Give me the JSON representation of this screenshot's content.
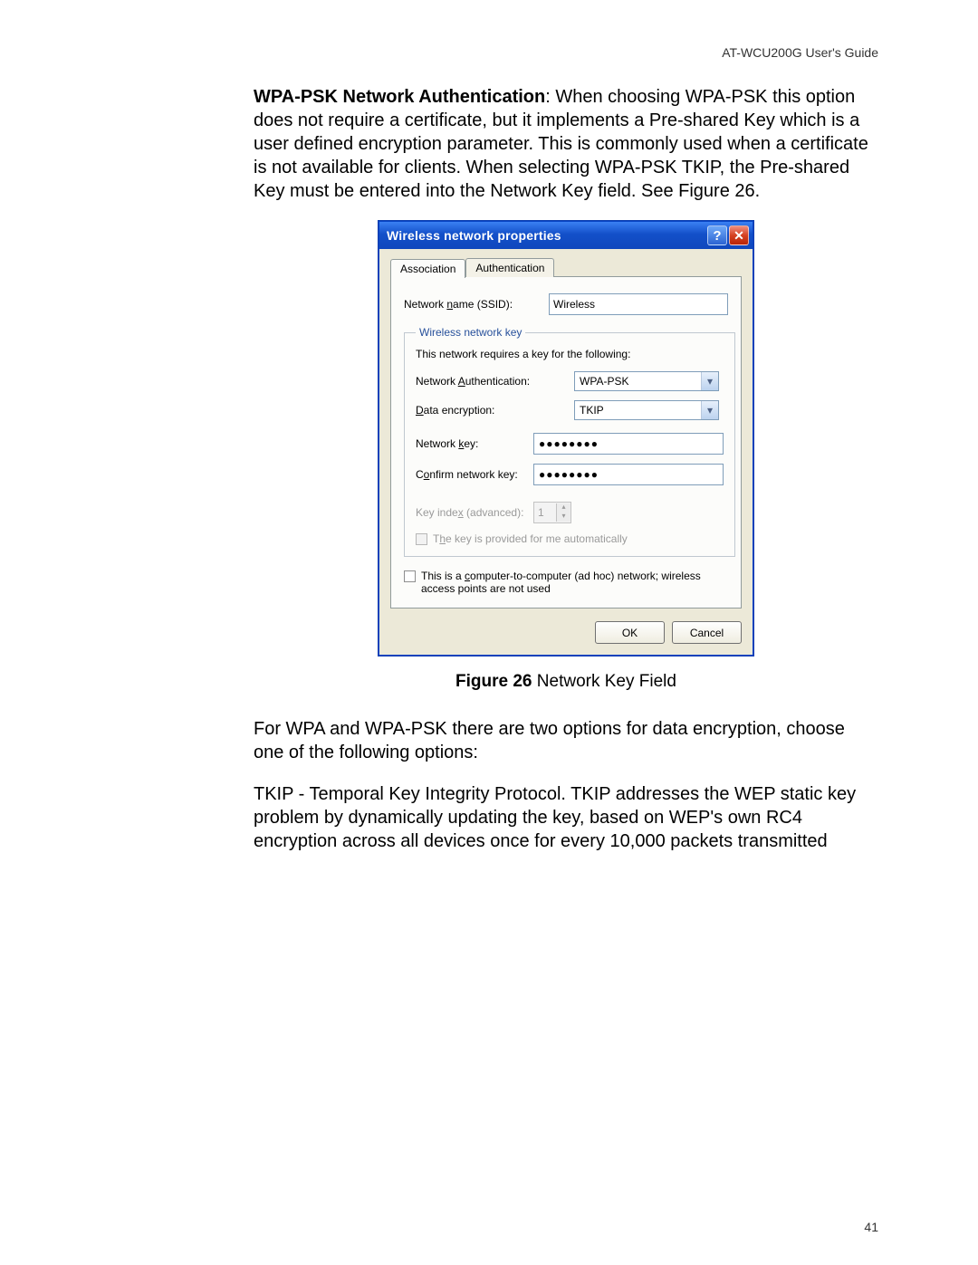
{
  "header_right": "AT-WCU200G User's Guide",
  "intro": {
    "bold_lead": "WPA-PSK Network Authentication",
    "rest": ": When choosing WPA-PSK this option does not require a certificate, but it implements a Pre-shared Key which is a user defined encryption parameter. This is commonly used when a certificate is not available for clients. When selecting WPA-PSK TKIP, the Pre-shared Key must be entered into the Network Key field. See Figure 26."
  },
  "dialog": {
    "title": "Wireless network properties",
    "help_icon": "?",
    "close_icon": "✕",
    "tabs": {
      "active": "Association",
      "inactive": "Authentication"
    },
    "ssid_label": "Network name (SSID):",
    "ssid_value": "Wireless",
    "group_legend": "Wireless network key",
    "group_text": "This network requires a key for the following:",
    "auth_label": "Network Authentication:",
    "auth_value": "WPA-PSK",
    "enc_label": "Data encryption:",
    "enc_value": "TKIP",
    "netkey_label": "Network key:",
    "netkey_value": "●●●●●●●●",
    "confirm_label": "Confirm network key:",
    "confirm_value": "●●●●●●●●",
    "keyindex_label": "Key index (advanced):",
    "keyindex_value": "1",
    "autokey_label": "The key is provided for me automatically",
    "adhoc_label": "This is a computer-to-computer (ad hoc) network; wireless access points are not used",
    "ok": "OK",
    "cancel": "Cancel"
  },
  "caption": {
    "bold": "Figure 26",
    "rest": "  Network Key Field"
  },
  "para2": "For WPA and WPA-PSK there are two options for data encryption, choose one of the following options:",
  "para3": "TKIP - Temporal Key Integrity Protocol. TKIP addresses the WEP static key problem by dynamically updating the key, based on WEP's own RC4 encryption across all devices once for every 10,000 packets transmitted",
  "page_number": "41"
}
